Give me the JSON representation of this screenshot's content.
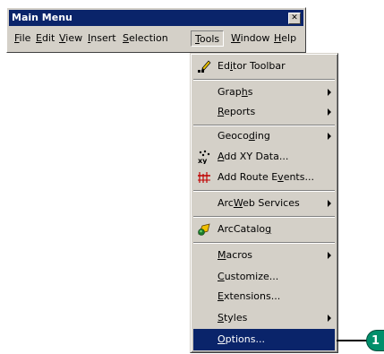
{
  "window": {
    "title": "Main Menu",
    "close_glyph": "✕"
  },
  "menubar": {
    "items": [
      {
        "pre": "",
        "u": "F",
        "post": "ile"
      },
      {
        "pre": "",
        "u": "E",
        "post": "dit"
      },
      {
        "pre": "",
        "u": "V",
        "post": "iew"
      },
      {
        "pre": "",
        "u": "I",
        "post": "nsert"
      },
      {
        "pre": "",
        "u": "S",
        "post": "election"
      },
      {
        "pre": "",
        "u": "T",
        "post": "ools"
      },
      {
        "pre": "",
        "u": "W",
        "post": "indow"
      },
      {
        "pre": "",
        "u": "H",
        "post": "elp"
      }
    ]
  },
  "tools_menu": {
    "items": [
      {
        "pre": "Ed",
        "u": "i",
        "post": "tor Toolbar",
        "icon": "editor-icon"
      },
      {
        "pre": "Grap",
        "u": "h",
        "post": "s",
        "submenu": true
      },
      {
        "pre": "",
        "u": "R",
        "post": "eports",
        "submenu": true
      },
      {
        "pre": "Geoco",
        "u": "d",
        "post": "ing",
        "submenu": true
      },
      {
        "pre": "",
        "u": "A",
        "post": "dd XY Data...",
        "icon": "xy-data-icon"
      },
      {
        "pre": "Add Route E",
        "u": "v",
        "post": "ents...",
        "icon": "route-events-icon"
      },
      {
        "pre": "Arc",
        "u": "W",
        "post": "eb Services",
        "submenu": true
      },
      {
        "pre": "ArcCatalo",
        "u": "g",
        "post": "",
        "icon": "arccatalog-icon"
      },
      {
        "pre": "",
        "u": "M",
        "post": "acros",
        "submenu": true
      },
      {
        "pre": "",
        "u": "C",
        "post": "ustomize..."
      },
      {
        "pre": "",
        "u": "E",
        "post": "xtensions..."
      },
      {
        "pre": "",
        "u": "S",
        "post": "tyles",
        "submenu": true
      },
      {
        "pre": "",
        "u": "O",
        "post": "ptions...",
        "selected": true
      }
    ]
  },
  "callout": {
    "number": "1",
    "color": "#008f6b"
  },
  "colors": {
    "titlebar": "#0a246a",
    "selection": "#0a246a",
    "face": "#d4d0c8"
  }
}
